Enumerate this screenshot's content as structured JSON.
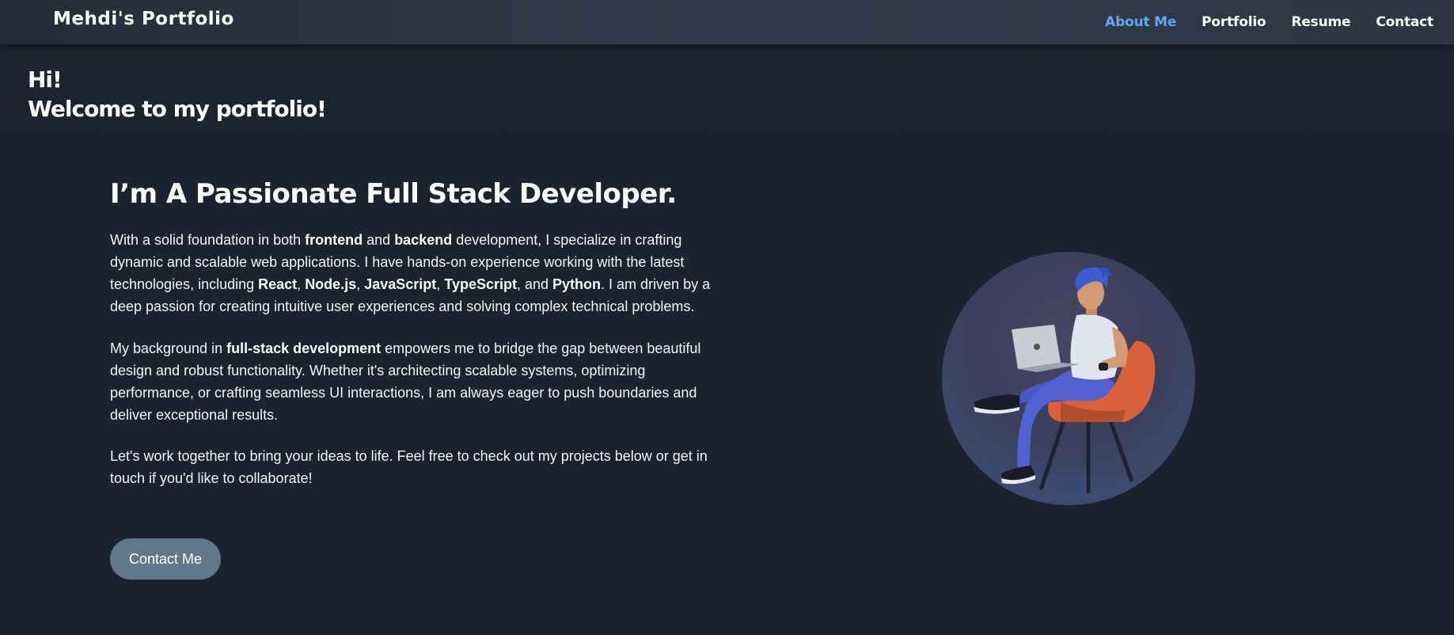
{
  "navbar": {
    "brand": "Mehdi's Portfolio",
    "links": [
      {
        "label": "About Me",
        "active": true
      },
      {
        "label": "Portfolio",
        "active": false
      },
      {
        "label": "Resume",
        "active": false
      },
      {
        "label": "Contact",
        "active": false
      }
    ]
  },
  "hero": {
    "greeting_line1": "Hi!",
    "greeting_line2": "Welcome to my portfolio!",
    "headline": "I’m A Passionate Full Stack Developer.",
    "paragraph1": {
      "t1": "With a solid foundation in both ",
      "b1": "frontend",
      "t2": " and ",
      "b2": "backend",
      "t3": " development, I specialize in crafting dynamic and scalable web applications. I have hands-on experience working with the latest technologies, including ",
      "b3": "React",
      "t4": ", ",
      "b4": "Node.js",
      "t5": ", ",
      "b5": "JavaScript",
      "t6": ", ",
      "b6": "TypeScript",
      "t7": ", and ",
      "b7": "Python",
      "t8": ". I am driven by a deep passion for creating intuitive user experiences and solving complex technical problems."
    },
    "paragraph2": {
      "t1": "My background in ",
      "b1": "full-stack development",
      "t2": " empowers me to bridge the gap between beautiful design and robust functionality. Whether it's architecting scalable systems, optimizing performance, or crafting seamless UI interactions, I am always eager to push boundaries and deliver exceptional results."
    },
    "paragraph3": "Let's work together to bring your ideas to life. Feel free to check out my projects below or get in touch if you'd like to collaborate!",
    "contact_button": "Contact Me"
  },
  "colors": {
    "accent": "#63a7f0",
    "background": "#1b2230",
    "button": "#607888"
  },
  "icons": {
    "avatar": "developer-with-laptop-illustration"
  }
}
